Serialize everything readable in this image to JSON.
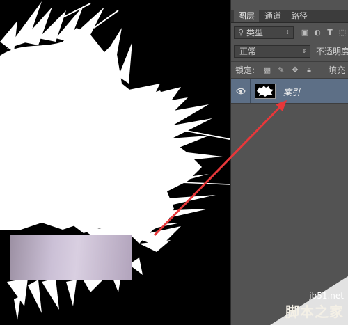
{
  "panel": {
    "tabs": [
      {
        "label": "图层",
        "active": true
      },
      {
        "label": "通道",
        "active": false
      },
      {
        "label": "路径",
        "active": false
      }
    ],
    "filter": {
      "kind_label": "类型",
      "search_icon": "search-icon"
    },
    "blend_mode": "正常",
    "opacity_label": "不透明度",
    "lock_label": "锁定:",
    "fill_label": "填充",
    "layer": {
      "name": "案引",
      "visible": true
    }
  },
  "annotation": {
    "arrow_color": "#e8373a"
  },
  "watermark": {
    "url": "jb51.net",
    "site_name": "脚本之家"
  },
  "colors": {
    "panel_bg": "#535353",
    "selected_layer": "#5d6f86",
    "canvas_bg": "#000000"
  }
}
